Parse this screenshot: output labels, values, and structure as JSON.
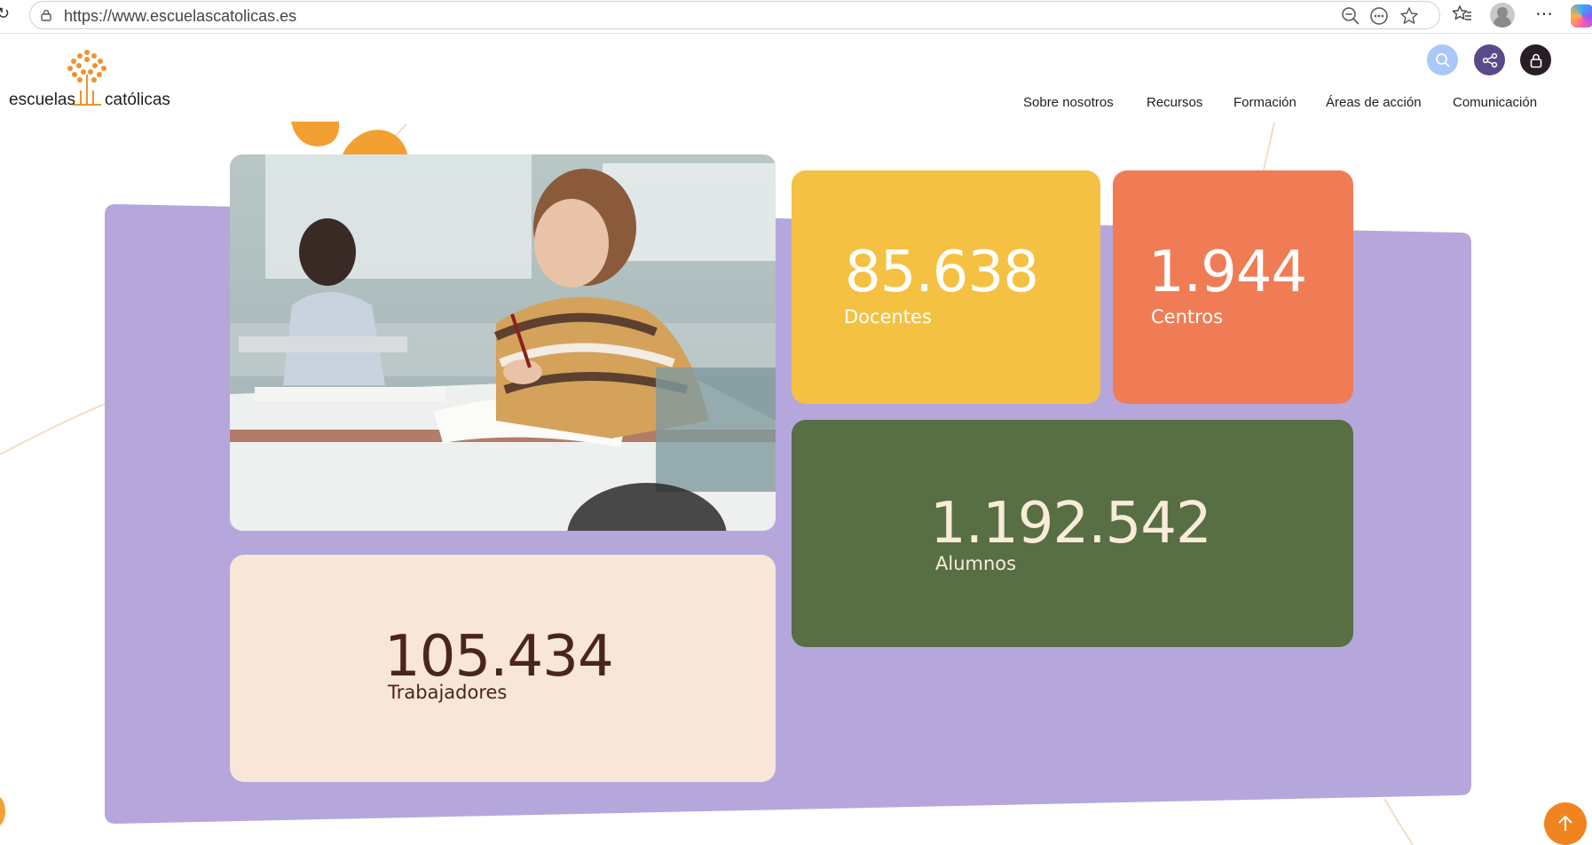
{
  "browser": {
    "url": "https://www.escuelascatolicas.es",
    "icons": [
      "reload-icon",
      "lock-icon",
      "zoom-out-icon",
      "page-actions-icon",
      "favorite-star-icon",
      "favorites-list-icon",
      "profile-icon",
      "more-icon",
      "copilot-icon"
    ]
  },
  "site": {
    "logo": {
      "left_text": "escuelas",
      "right_text": "católicas"
    },
    "actions": [
      "search-icon",
      "share-icon",
      "lock-icon"
    ],
    "nav": [
      {
        "label": "Sobre nosotros"
      },
      {
        "label": "Recursos"
      },
      {
        "label": "Formación"
      },
      {
        "label": "Áreas de acción"
      },
      {
        "label": "Comunicación"
      }
    ]
  },
  "stats": {
    "docentes": {
      "value": "85.638",
      "label": "Docentes"
    },
    "centros": {
      "value": "1.944",
      "label": "Centros"
    },
    "alumnos": {
      "value": "1.192.542",
      "label": "Alumnos"
    },
    "trabajadores": {
      "value": "105.434",
      "label": "Trabajadores"
    }
  },
  "colors": {
    "panel": "#b5a7dc",
    "docentes": "#f5c142",
    "centros": "#f07c55",
    "alumnos": "#586e43",
    "trabajadores": "#f8e6d8",
    "accent_orange": "#f3a033",
    "dark_text": "#4a2420",
    "light_text": "#f8ecd9"
  }
}
